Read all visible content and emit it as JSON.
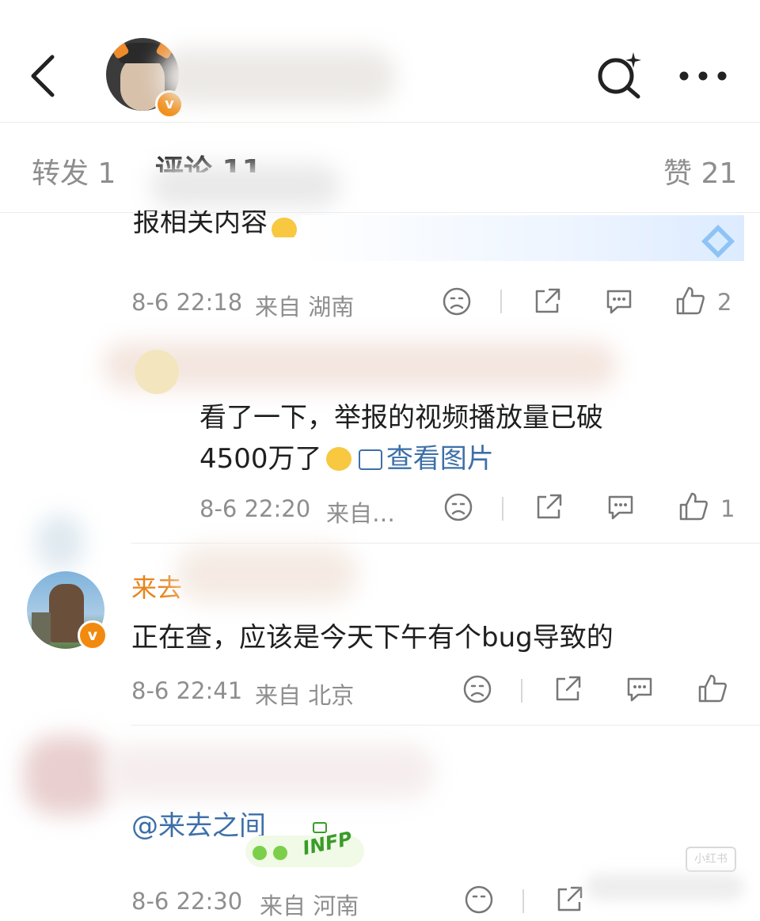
{
  "header": {
    "back_icon": "chevron-left-icon",
    "search_icon": "magic-search-icon",
    "more_icon": "more-dots-icon"
  },
  "tabs": {
    "repost": "转发 1",
    "comments": "评论 11",
    "likes": "赞 21"
  },
  "comments": [
    {
      "text": "报相关内容",
      "time": "8-6 22:18",
      "source": "来自 湖南",
      "like_count": "2"
    },
    {
      "text_line1": "看了一下，举报的视频播放量已破",
      "text_line2": "4500万了",
      "view_image": "查看图片",
      "time": "8-6 22:20",
      "source": "来自…",
      "like_count": "1"
    },
    {
      "author": "来去",
      "text": "正在查，应该是今天下午有个bug导致的",
      "time": "8-6 22:41",
      "source": "来自 北京",
      "like_count": ""
    },
    {
      "text": "@来去之间",
      "badge": "INFP",
      "time": "8-6 22:30",
      "source": "来自 河南"
    }
  ],
  "watermark": "小红书",
  "colors": {
    "accent_orange": "#e8841c",
    "link_blue": "#3d6fa8",
    "verified_orange": "#f28a0f"
  }
}
